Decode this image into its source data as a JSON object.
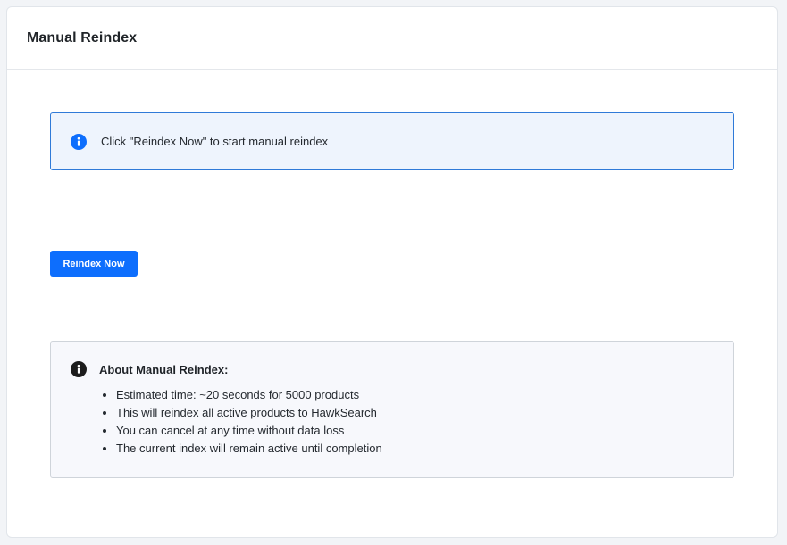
{
  "header": {
    "title": "Manual Reindex"
  },
  "alert": {
    "icon": "info-circle-icon",
    "color": "#0d6efd",
    "message": "Click \"Reindex Now\" to start manual reindex"
  },
  "actions": {
    "reindex_label": "Reindex Now",
    "color": "#0d6efd"
  },
  "about": {
    "icon": "info-circle-icon",
    "title": "About Manual Reindex:",
    "items": [
      "Estimated time: ~20 seconds for 5000 products",
      "This will reindex all active products to HawkSearch",
      "You can cancel at any time without data loss",
      "The current index will remain active until completion"
    ]
  }
}
